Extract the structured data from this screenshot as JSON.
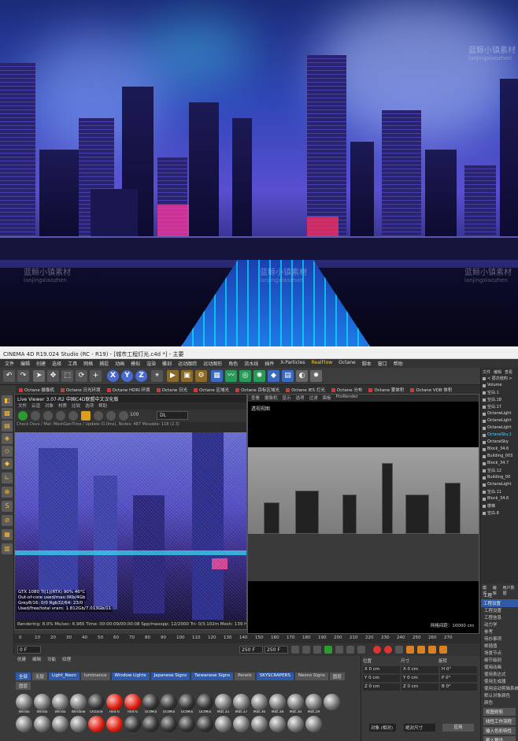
{
  "hero": {
    "watermark_cn": "蓝鲸小镇素材",
    "watermark_en": "lanjingxiaozhen",
    "watermark_cn_left": "蓝鲸小镇素材",
    "watermark_en_left": "lanjingxiaozhen",
    "watermark_cn_mid": "蓝鲸小镇素材",
    "watermark_en_mid": "lanjingxiaozhen",
    "watermark_cn_right": "蓝鲸小镇素材",
    "watermark_en_right": "lanjingxiaozhen"
  },
  "window": {
    "title": "CINEMA 4D R19.024 Studio (RC - R19) - [城市工程灯光.c4d *] - 主要"
  },
  "menubar": {
    "items": [
      "文件",
      "编辑",
      "创建",
      "选择",
      "工具",
      "网格",
      "捕捉",
      "动画",
      "模拟",
      "渲染",
      "雕刻",
      "运动跟踪",
      "运动图形",
      "角色",
      "流水线",
      "插件",
      "X-Particles",
      "RealFlow",
      "Octane",
      "脚本",
      "窗口",
      "帮助"
    ]
  },
  "toolbar": {
    "xyz": [
      "X",
      "Y",
      "Z"
    ]
  },
  "octane_bar": {
    "items": [
      "Octane 摄像机",
      "Octane 日光环境",
      "Octane HDRI 环境",
      "Octane 日光",
      "Octane 区域光",
      "Octane 目标区域光",
      "Octane IES 灯光",
      "Octane 分布",
      "Octane 雾体积",
      "Octane VDB 体积"
    ]
  },
  "live_viewer": {
    "title": "Live Viewer 3.07-R2 中国C4D联盟中文汉化版",
    "menu": [
      "文件",
      "云渲",
      "对象",
      "材质",
      "比较",
      "选项",
      "帮助"
    ],
    "zoom": "100",
    "mode": "DL",
    "info_line": "Check Devs / Mat: MeshGenTime / Update (0.0ms), Nodes: 487 Movable: 118 (2.3)",
    "stats": [
      "GTX 1080 Ti[1](RTX)          90%     46°C",
      "Out-of-core used/max:0Kb/4Gb",
      "Grey8/16: 0/0          Rgb32/64: 23/0",
      "Used/free/total vram: 1.812Gb/7.013Gb/11"
    ],
    "status": "Rendering: 8.0%    Ms/sec: 6.965    Time: 00:00:09/00:00:08    Spp/maxspp: 12/2000    Tri: 0/3.102m  Mesh: 139  Hai"
  },
  "viewport": {
    "menu": [
      "查看",
      "摄像机",
      "显示",
      "选项",
      "过滤",
      "面板",
      "ProRender"
    ],
    "label": "透视视图",
    "size_label": "网格间距：10000 cm"
  },
  "timeline": {
    "ticks": [
      "0",
      "10",
      "20",
      "30",
      "40",
      "50",
      "60",
      "70",
      "80",
      "90",
      "100",
      "110",
      "120",
      "130",
      "140",
      "150",
      "160",
      "170",
      "180",
      "190",
      "200",
      "210",
      "220",
      "230",
      "240",
      "250",
      "260",
      "270"
    ]
  },
  "playbar": {
    "frame_start": "0 F",
    "frame_current": "0 F",
    "frame_end": "250 F",
    "frame_end2": "250 F"
  },
  "materials": {
    "menu": [
      "创建",
      "编辑",
      "功能",
      "纹理"
    ],
    "tabs": [
      {
        "label": "全部",
        "active": true
      },
      {
        "label": "无层",
        "active": false
      },
      {
        "label": "Light_Neon",
        "active": true
      },
      {
        "label": "luminance",
        "active": false
      },
      {
        "label": "Window Lights",
        "active": true
      },
      {
        "label": "Japanese Signs",
        "active": true
      },
      {
        "label": "Taiwanese Signs",
        "active": true
      },
      {
        "label": "Panels",
        "active": false
      },
      {
        "label": "SKYSCRAPERS",
        "active": true
      },
      {
        "label": "Neons Signs",
        "active": false
      },
      {
        "label": "图层",
        "active": false
      },
      {
        "label": "图层",
        "active": false
      }
    ],
    "balls": [
      {
        "label": "Windo",
        "kind": "grey"
      },
      {
        "label": "Windo",
        "kind": "grey"
      },
      {
        "label": "Windo",
        "kind": "grey"
      },
      {
        "label": "Window",
        "kind": "grey"
      },
      {
        "label": "Octane",
        "kind": "dark"
      },
      {
        "label": "Red 6",
        "kind": "red"
      },
      {
        "label": "Red 6",
        "kind": "red"
      },
      {
        "label": "OctMix",
        "kind": "dark"
      },
      {
        "label": "OctMix",
        "kind": "dark"
      },
      {
        "label": "OctMix",
        "kind": "dark"
      },
      {
        "label": "OctMix",
        "kind": "dark"
      },
      {
        "label": "Mat.35",
        "kind": "grey"
      },
      {
        "label": "Mat.37",
        "kind": "grey"
      },
      {
        "label": "Mat.36",
        "kind": "grey"
      },
      {
        "label": "Mat.38",
        "kind": "grey"
      },
      {
        "label": "Mat.30",
        "kind": "grey"
      },
      {
        "label": "Mat.29",
        "kind": "grey"
      },
      {
        "label": "",
        "kind": "grey"
      },
      {
        "label": "",
        "kind": "grey"
      },
      {
        "label": "",
        "kind": "grey"
      },
      {
        "label": "",
        "kind": "grey"
      },
      {
        "label": "",
        "kind": "grey"
      },
      {
        "label": "",
        "kind": "red"
      },
      {
        "label": "",
        "kind": "red"
      },
      {
        "label": "",
        "kind": "dark"
      },
      {
        "label": "",
        "kind": "dark"
      },
      {
        "label": "",
        "kind": "dark"
      },
      {
        "label": "",
        "kind": "dark"
      },
      {
        "label": "",
        "kind": "dark"
      },
      {
        "label": "",
        "kind": "grey"
      },
      {
        "label": "",
        "kind": "grey"
      },
      {
        "label": "",
        "kind": "grey"
      },
      {
        "label": "",
        "kind": "grey"
      },
      {
        "label": "",
        "kind": "grey"
      },
      {
        "label": "",
        "kind": "grey"
      }
    ]
  },
  "attributes": {
    "headers": [
      "位置",
      "尺寸",
      "旋转"
    ],
    "rows": [
      [
        "X  0 cm",
        "X  0 cm",
        "H  0°"
      ],
      [
        "Y  0 cm",
        "Y  0 cm",
        "P  0°"
      ],
      [
        "Z  0 cm",
        "Z  0 cm",
        "B  0°"
      ]
    ],
    "object_select": "对象 (相对)",
    "size_select": "绝对尺寸",
    "apply": "应用"
  },
  "object_manager": {
    "menu": [
      "文件",
      "编辑",
      "查看"
    ],
    "items": [
      {
        "label": "< 层次结构 >",
        "hl": false
      },
      {
        "label": "Volume",
        "hl": false
      },
      {
        "label": "空白.1",
        "hl": false
      },
      {
        "label": "空白.18",
        "hl": false
      },
      {
        "label": "空白.17",
        "hl": false
      },
      {
        "label": "OctaneLight",
        "hl": false
      },
      {
        "label": "OctaneLight",
        "hl": false
      },
      {
        "label": "OctaneLight",
        "hl": false
      },
      {
        "label": "OctaneSky.1",
        "hl": true
      },
      {
        "label": "OctaneSky",
        "hl": false
      },
      {
        "label": "Block_34.6",
        "hl": false
      },
      {
        "label": "Building_003",
        "hl": false
      },
      {
        "label": "Block_34.7",
        "hl": false
      },
      {
        "label": "空白.12",
        "hl": false
      },
      {
        "label": "Building_00",
        "hl": false
      },
      {
        "label": "OctaneLight",
        "hl": false
      },
      {
        "label": "空白.11",
        "hl": false
      },
      {
        "label": "Block_34.6",
        "hl": false
      },
      {
        "label": "楼梯",
        "hl": false
      },
      {
        "label": "空白.8",
        "hl": false
      }
    ]
  },
  "project": {
    "tabs": [
      "模式",
      "编辑",
      "用户数据"
    ],
    "title_tab": "工程",
    "active_tab": "工程设置",
    "items": [
      "工程设置",
      "工程信息",
      "动力学",
      "参考",
      "待办事项",
      "帧插值",
      "场景节点",
      "细节级别",
      "使用动画",
      "使用表达式",
      "使用生成器",
      "使用运动剪辑系统",
      "默认对象颜色",
      "颜色"
    ],
    "buttons": [
      "视图修剪",
      "线性工作流程",
      "输入色彩特性",
      "载入预设"
    ]
  }
}
